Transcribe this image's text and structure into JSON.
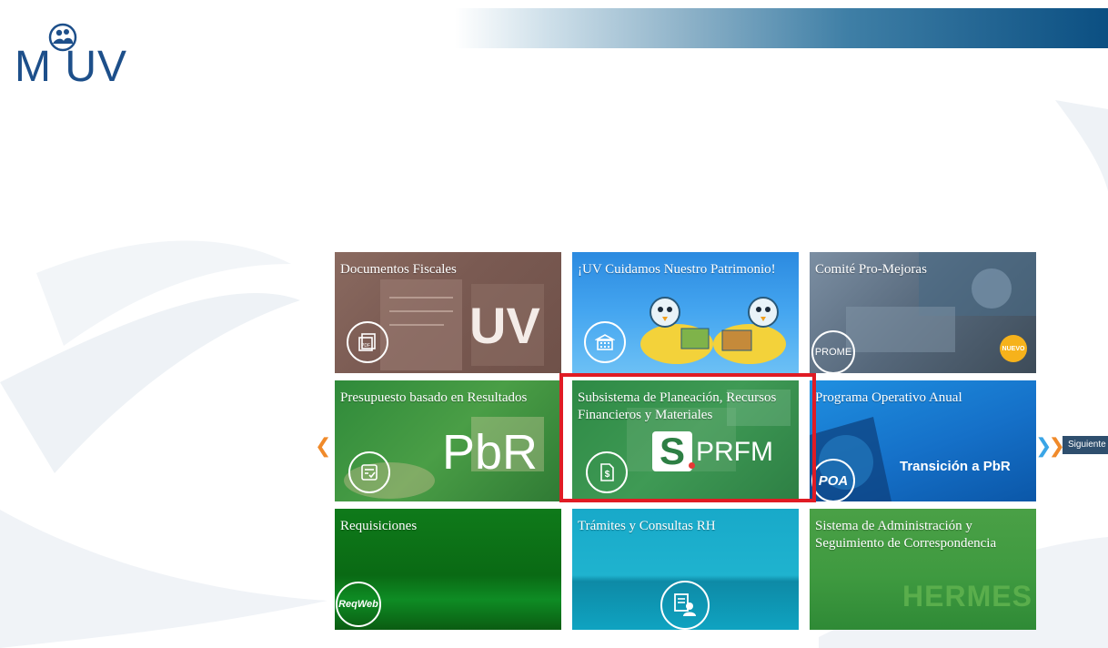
{
  "header": {
    "logo_text": "M  UV"
  },
  "tiles": [
    {
      "title": "Documentos Fiscales",
      "badge": "UV",
      "icon": "pdf-icon"
    },
    {
      "title": "¡UV Cuidamos Nuestro Patrimonio!",
      "icon": "building-icon"
    },
    {
      "title": "Comité Pro-Mejoras",
      "icon_text": "PROME",
      "badge": "NUEVO"
    },
    {
      "title": "Presupuesto basado en Resultados",
      "badge": "PbR",
      "icon": "checklist-icon"
    },
    {
      "title": "Subsistema de Planeación, Recursos Financieros y Materiales",
      "badge_s": "S",
      "badge": "PRFM",
      "icon": "money-document-icon"
    },
    {
      "title": "Programa Operativo Anual",
      "icon_text": "POA",
      "badge": "Transición a PbR"
    },
    {
      "title": "Requisiciones",
      "icon_text": "ReqWeb"
    },
    {
      "title": "Trámites y Consultas RH",
      "icon": "user-document-icon"
    },
    {
      "title": "Sistema de Administración y Seguimiento de Correspondencia",
      "badge": "HERMES"
    }
  ],
  "nav": {
    "prev_glyph": "❮",
    "next_glyph": "❯",
    "next_label": "Siguiente"
  },
  "colors": {
    "highlight": "#e01b24",
    "brand": "#1d4f8a"
  }
}
